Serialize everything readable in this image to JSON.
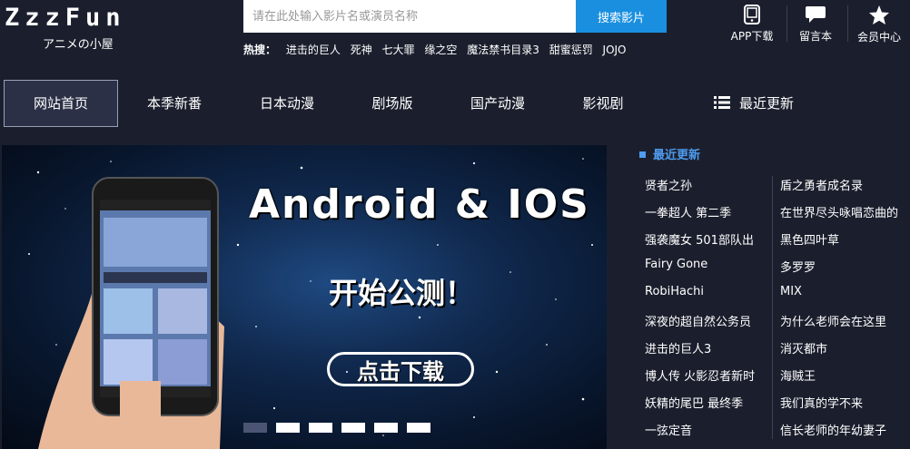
{
  "header": {
    "logo_text": "ZzzFun",
    "logo_sub": "アニメの小屋",
    "search": {
      "placeholder": "请在此处输入影片名或演员名称",
      "button": "搜索影片"
    },
    "hot_label": "热搜：",
    "hot_items": [
      "进击的巨人",
      "死神",
      "七大罪",
      "缘之空",
      "魔法禁书目录3",
      "甜蜜惩罚",
      "JOJO"
    ],
    "tools": [
      {
        "label": "APP下载",
        "icon": "tablet-icon"
      },
      {
        "label": "留言本",
        "icon": "chat-bubble-icon"
      },
      {
        "label": "会员中心",
        "icon": "star-icon"
      }
    ]
  },
  "nav": {
    "items": [
      "网站首页",
      "本季新番",
      "日本动漫",
      "剧场版",
      "国产动漫",
      "影视剧"
    ],
    "latest": "最近更新",
    "active_index": 0
  },
  "banner": {
    "title": "Android & IOS",
    "subtitle": "开始公测！",
    "button": "点击下载",
    "slide_count": 6,
    "active_slide": 0
  },
  "sidebar": {
    "title": "最近更新",
    "left": [
      "贤者之孙",
      "一拳超人 第二季",
      "强袭魔女 501部队出",
      "Fairy Gone",
      "RobiHachi",
      "深夜的超自然公务员",
      "进击的巨人3",
      "博人传 火影忍者新时",
      "妖精的尾巴 最终季",
      "一弦定音"
    ],
    "right": [
      "盾之勇者成名录",
      "在世界尽头咏唱恋曲的",
      "黑色四叶草",
      "多罗罗",
      "MIX",
      "为什么老师会在这里",
      "消灭都市",
      "海贼王",
      "我们真的学不来",
      "信长老师的年幼妻子"
    ]
  },
  "colors": {
    "background": "#1b1f2d",
    "accent": "#1a8fe0",
    "sidebar_title": "#4f9cf0",
    "active_nav": "#2b3046"
  }
}
